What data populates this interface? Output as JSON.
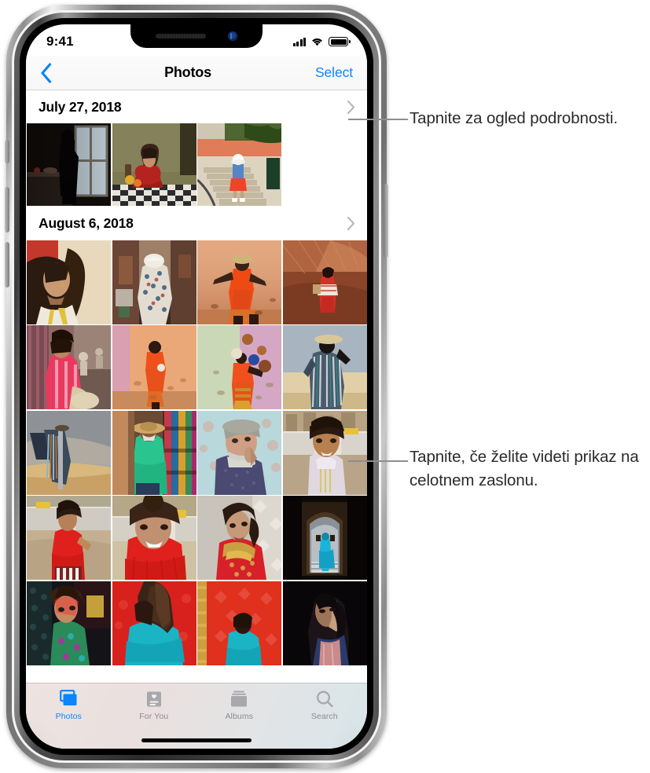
{
  "device": {
    "kind": "iphone-x",
    "notch": {
      "speaker": "speaker-grille",
      "camera": "front-camera"
    }
  },
  "status_bar": {
    "time": "9:41",
    "cellular_icon": "signal-bars-icon",
    "cellular_bars": 4,
    "wifi_icon": "wifi-icon",
    "battery_icon": "battery-full-icon",
    "battery_level": 100
  },
  "nav_bar": {
    "back_icon": "chevron-left-icon",
    "title": "Photos",
    "action_label": "Select",
    "accent_color": "#0a84ff"
  },
  "sections": [
    {
      "date_label": "July 27, 2018",
      "disclosure_icon": "chevron-right-icon",
      "photo_count": 3,
      "rows": [
        [
          {
            "name": "silhouette-at-window",
            "desc": "woman silhouetted in dark room by bright window"
          },
          {
            "name": "woman-red-shirt-checkered-table",
            "desc": "woman in red tee at checkered tablecloth"
          },
          {
            "name": "girl-white-hat-stairs",
            "desc": "girl in blue and red dress on stone stairs"
          },
          {
            "name": "empty-slot",
            "desc": ""
          }
        ]
      ]
    },
    {
      "date_label": "August 6, 2018",
      "disclosure_icon": "chevron-right-icon",
      "photo_count": 20,
      "rows": [
        [
          {
            "name": "curly-hair-portrait",
            "desc": "woman with curly hair, yellow accents"
          },
          {
            "name": "man-patterned-shirt-alley",
            "desc": "man in patterned shirt walking alley"
          },
          {
            "name": "footballer-orange-wall",
            "desc": "boy in orange kicking ball, peach wall"
          },
          {
            "name": "woman-red-dress-dunes",
            "desc": "woman in red dress on red dunes"
          }
        ],
        [
          {
            "name": "woman-pink-pattern-street",
            "desc": "woman in pink patterned dress, street"
          },
          {
            "name": "boy-orange-pink-wall",
            "desc": "boy in orange outfit, pink wall"
          },
          {
            "name": "juggler-green-wall",
            "desc": "juggler with balls, green and pink wall"
          },
          {
            "name": "striped-robe-sunset",
            "desc": "figure in striped robe with hat at sunset"
          }
        ],
        [
          {
            "name": "hanging-textile-sky",
            "desc": "striped textile hanging against cloudy sky"
          },
          {
            "name": "man-straw-hat-green-shirt",
            "desc": "man in straw hat and green shirt at shop"
          },
          {
            "name": "older-man-flat-cap",
            "desc": "older bearded man in flat cap"
          },
          {
            "name": "smiling-girl-white-dress",
            "desc": "smiling girl in white embroidered dress"
          }
        ],
        [
          {
            "name": "woman-red-top-taxi",
            "desc": "woman in red top standing by taxi"
          },
          {
            "name": "woman-red-sweater-closeup",
            "desc": "close portrait of woman in red sweater"
          },
          {
            "name": "woman-red-embroidered-dress",
            "desc": "woman in red embroidered dress, profile"
          },
          {
            "name": "blue-figure-archway",
            "desc": "figure in blue robe in dark archway"
          }
        ],
        [
          {
            "name": "woman-green-neon-light",
            "desc": "woman lit with green and red light"
          },
          {
            "name": "man-teal-robe-red-wall",
            "desc": "man in teal robe before red wall"
          },
          {
            "name": "boy-teal-robe-red-tapestry",
            "desc": "boy in teal robe before red tapestry"
          },
          {
            "name": "woman-dark-portrait",
            "desc": "woman in profile, dark dramatic light"
          }
        ]
      ]
    }
  ],
  "tab_bar": {
    "items": [
      {
        "label": "Photos",
        "icon": "photos-stack-icon",
        "active": true
      },
      {
        "label": "For You",
        "icon": "for-you-card-icon",
        "active": false
      },
      {
        "label": "Albums",
        "icon": "albums-icon",
        "active": false
      },
      {
        "label": "Search",
        "icon": "magnifier-icon",
        "active": false
      }
    ],
    "active_color": "#0a84ff",
    "inactive_color": "#8b8b90"
  },
  "home_indicator": "home-indicator",
  "callouts": [
    {
      "id": "callout-1",
      "text": "Tapnite za ogled podrobnosti."
    },
    {
      "id": "callout-2",
      "text": "Tapnite, če želite videti prikaz na celotnem zaslonu."
    }
  ]
}
